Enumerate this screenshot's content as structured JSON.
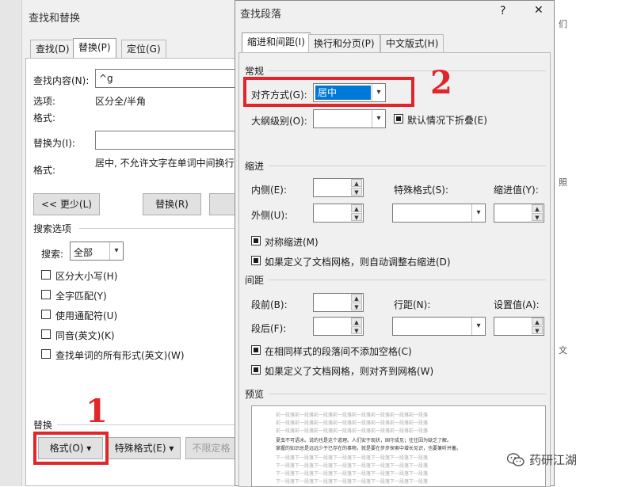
{
  "doc_bg": {
    "snippets": [
      "们",
      "照",
      "文"
    ]
  },
  "find_replace": {
    "title": "查找和替换",
    "tabs": [
      {
        "label": "查找(D)"
      },
      {
        "label": "替换(P)"
      },
      {
        "label": "定位(G)"
      }
    ],
    "find_label": "查找内容(N):",
    "find_value": "^g",
    "options_label": "选项:",
    "options_value": "区分全/半角",
    "format_label": "格式:",
    "replace_label": "替换为(I):",
    "replace_value": "",
    "replace_format_label": "格式:",
    "replace_format_value": "居中, 不允许文字在单词中间换行",
    "less_button": "<< 更少(L)",
    "replace_button": "替换(R)",
    "search_options_title": "搜索选项",
    "search_label": "搜索:",
    "search_value": "全部",
    "checkboxes": [
      {
        "label": "区分大小写(H)"
      },
      {
        "label": "全字匹配(Y)"
      },
      {
        "label": "使用通配符(U)"
      },
      {
        "label": "同音(英文)(K)"
      },
      {
        "label": "查找单词的所有形式(英文)(W)"
      }
    ],
    "replace_section_title": "替换",
    "format_button": "格式(O) ▾",
    "special_button": "特殊格式(E) ▾",
    "no_format_button": "不限定格"
  },
  "paragraph": {
    "title": "查找段落",
    "help": "?",
    "close": "✕",
    "tabs": [
      {
        "label": "缩进和间距(I)"
      },
      {
        "label": "换行和分页(P)"
      },
      {
        "label": "中文版式(H)"
      }
    ],
    "general_title": "常规",
    "alignment_label": "对齐方式(G):",
    "alignment_value": "居中",
    "outline_label": "大纲级别(O):",
    "outline_value": "",
    "collapse_label": "默认情况下折叠(E)",
    "indent_title": "缩进",
    "inside_label": "内侧(E):",
    "outside_label": "外侧(U):",
    "special_label": "特殊格式(S):",
    "indent_value_label": "缩进值(Y):",
    "mirror_label": "对称缩进(M)",
    "auto_right_label": "如果定义了文档网格，则自动调整右缩进(D)",
    "spacing_title": "间距",
    "before_label": "段前(B):",
    "after_label": "段后(F):",
    "line_spacing_label": "行距(N):",
    "set_value_label": "设置值(A):",
    "no_space_label": "在相同样式的段落间不添加空格(C)",
    "snap_grid_label": "如果定义了文档网格，则对齐到网格(W)",
    "preview_title": "预览",
    "preview_prev_text": "前一段落前一段落前一段落前一段落前一段落前一段落前一段落前一段落",
    "preview_main_text": "夏虫不可语冰。说的也是这个道理。人们安于现状，固守成见；往往因为缺乏了解。",
    "preview_main_text2": "掌握的知识总是远远少于已存在的事物，就是要在步步探索中增长见识，也要兼听并蓄。",
    "preview_next_text": "下一段落下一段落下一段落下一段落下一段落下一段落下一段落下一段落"
  },
  "annotations": {
    "num1": "1",
    "num2": "2"
  },
  "watermark": {
    "text": "药研江湖"
  },
  "colors": {
    "annotation_red": "#e0252b",
    "selection_blue": "#0078d7"
  }
}
